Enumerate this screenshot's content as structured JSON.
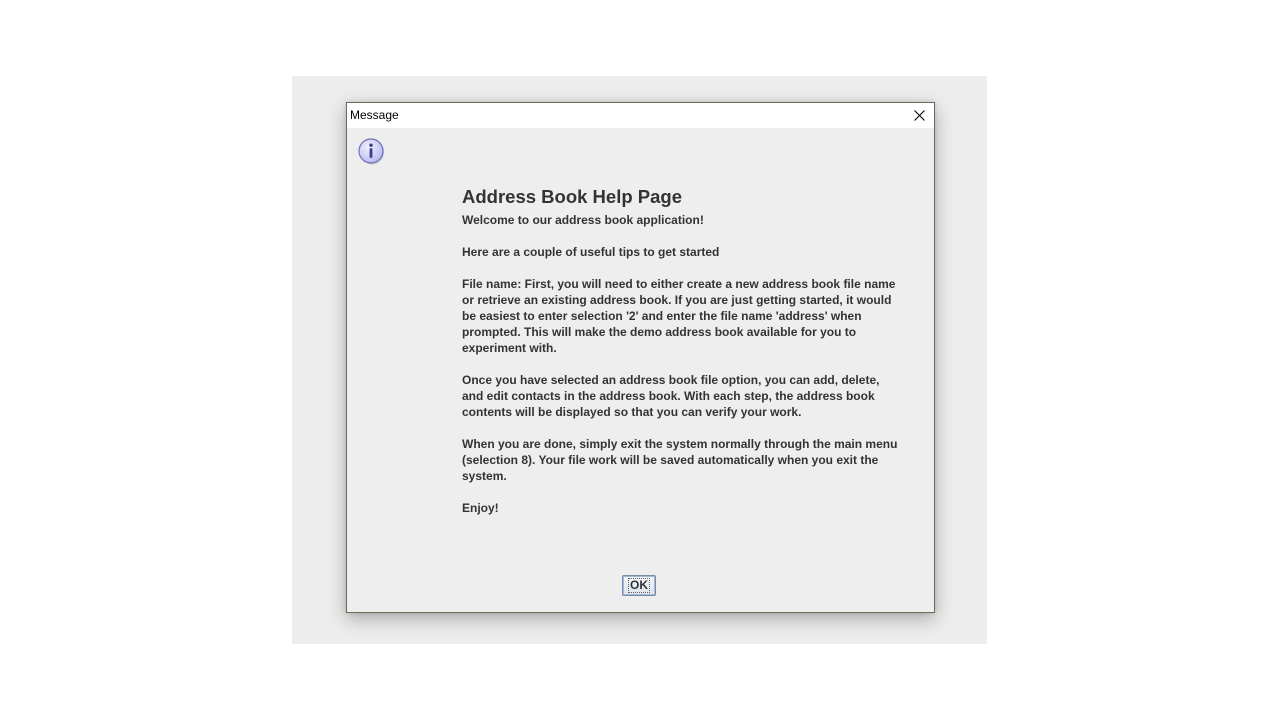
{
  "window": {
    "title": "Message"
  },
  "icons": {
    "close": "close-icon",
    "info": "information-icon"
  },
  "help": {
    "title": "Address Book Help Page",
    "welcome": "Welcome to our address book application!",
    "tips_intro": "Here are a couple of useful tips to get started",
    "file_name_tip": "File name: First, you will need to either create a new address book file name or retrieve an existing address book. If you are just getting started, it would be easiest to enter selection '2' and enter the file name 'address' when prompted. This will make the demo address book available for you to experiment with.",
    "edit_tip": "Once you have selected an address book file option, you can add, delete, and edit contacts in the address book. With each step, the address book contents will be displayed so that you can verify your work.",
    "exit_tip": "When you are done, simply exit the system normally through the main menu (selection 8). Your file work will be saved automatically when you exit the system.",
    "closing": "Enjoy!"
  },
  "buttons": {
    "ok_label": "OK"
  },
  "colors": {
    "dialog_background": "#eeeeee",
    "text": "#333333",
    "info_icon_fill": "#c9c8f2",
    "info_icon_stroke": "#6f6fb8"
  }
}
